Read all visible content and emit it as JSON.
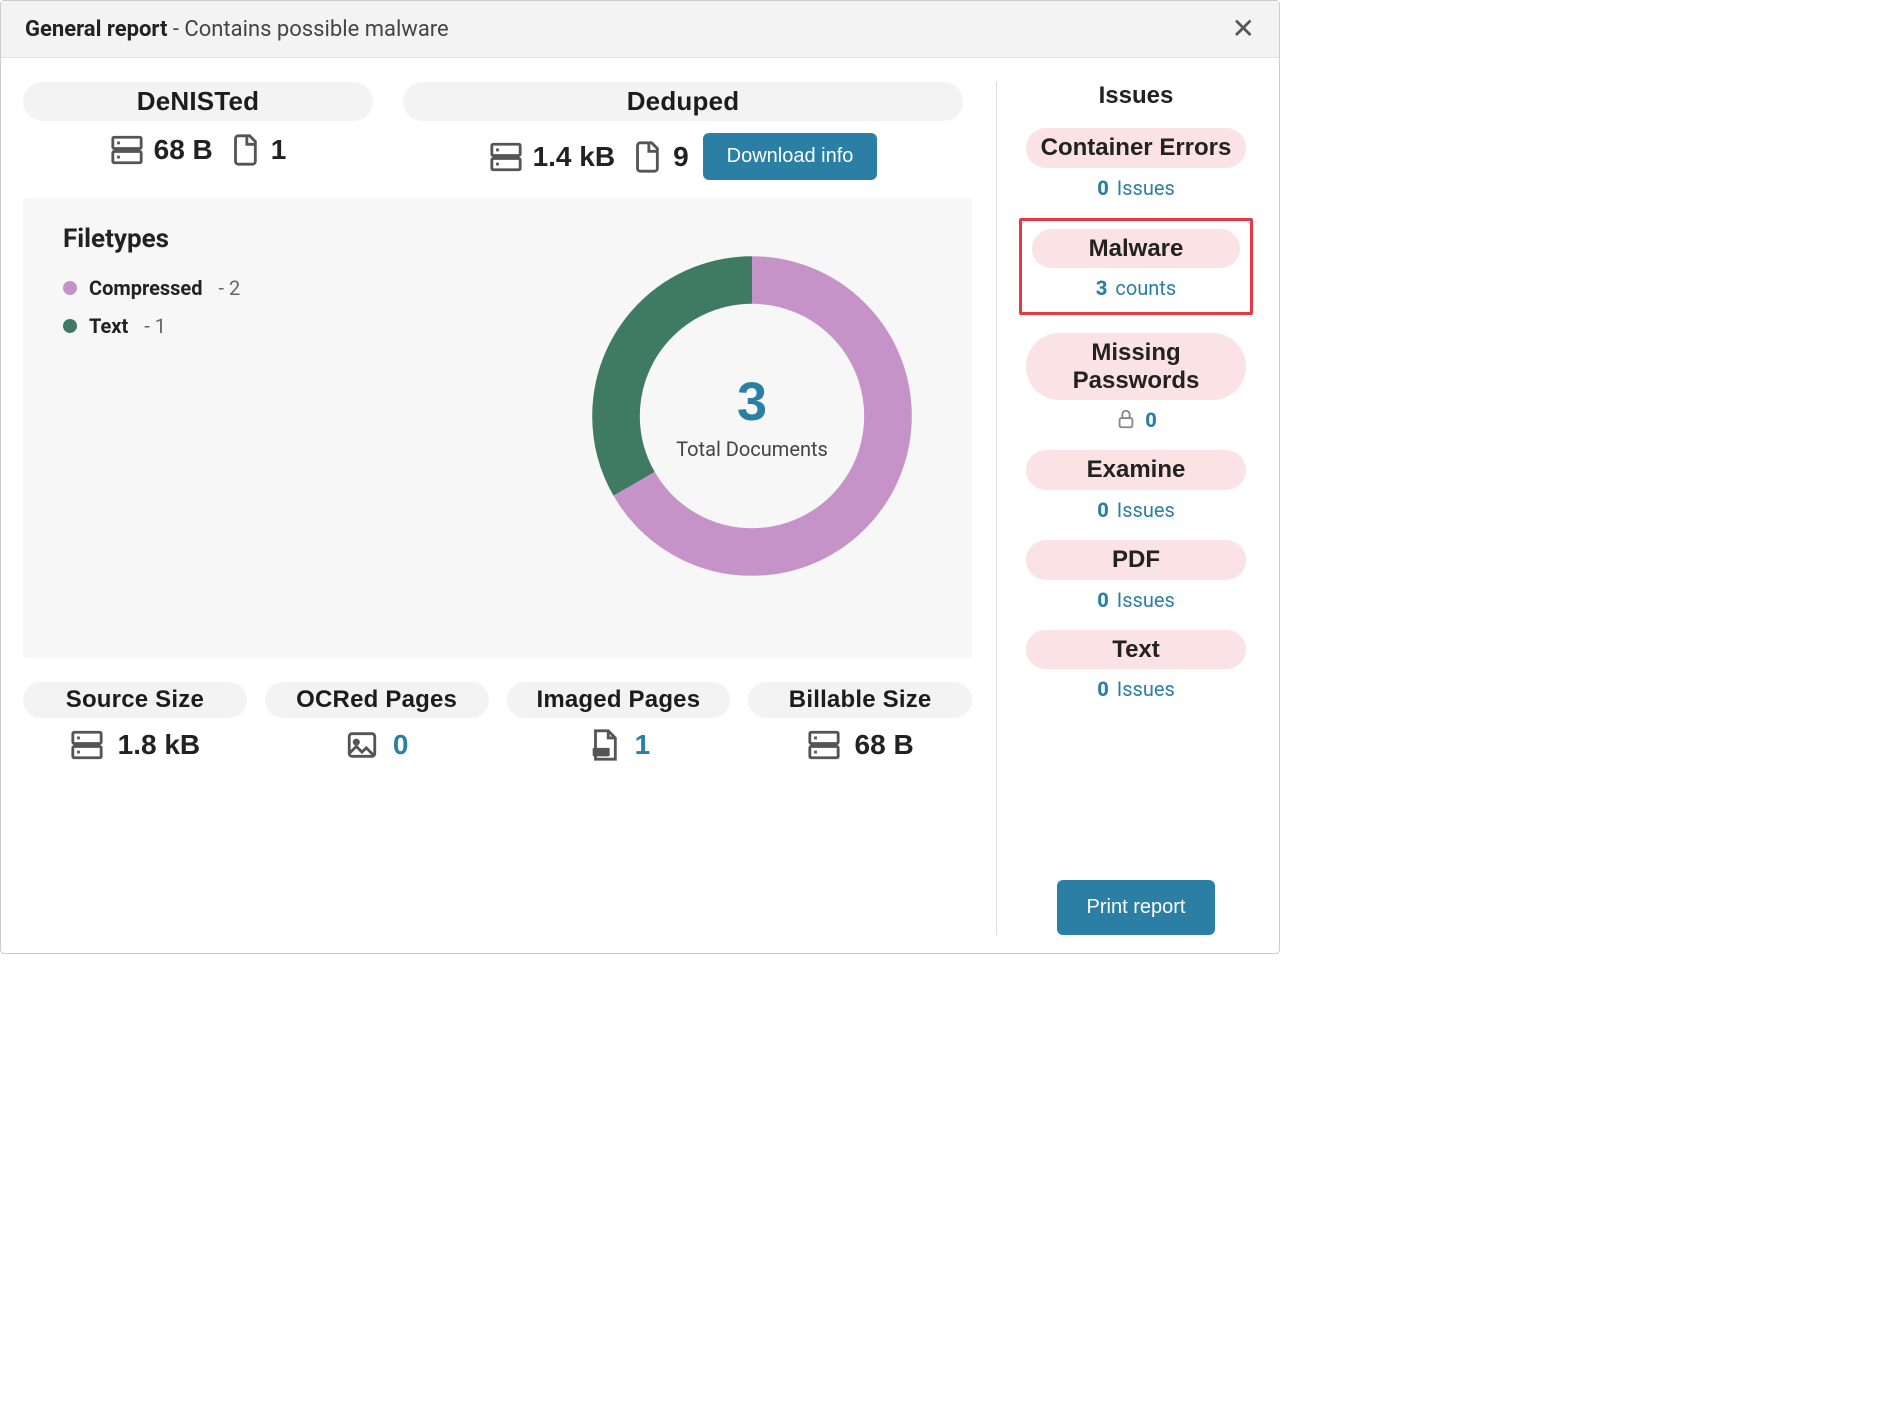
{
  "header": {
    "title_bold": "General report",
    "title_rest": " - Contains possible malware"
  },
  "top": {
    "denisted": {
      "label": "DeNISTed",
      "size": "68 B",
      "docs": "1"
    },
    "deduped": {
      "label": "Deduped",
      "size": "1.4 kB",
      "docs": "9",
      "download_label": "Download info"
    }
  },
  "filetypes": {
    "title": "Filetypes",
    "center_num": "3",
    "center_label": "Total Documents",
    "items": [
      {
        "name": "Compressed",
        "count": "2",
        "color": "#c593c7"
      },
      {
        "name": "Text",
        "count": "1",
        "color": "#3f7a63"
      }
    ]
  },
  "bottom": {
    "source": {
      "label": "Source Size",
      "value": "1.8 kB"
    },
    "ocr": {
      "label": "OCRed Pages",
      "value": "0"
    },
    "imaged": {
      "label": "Imaged Pages",
      "value": "1"
    },
    "billable": {
      "label": "Billable Size",
      "value": "68 B"
    }
  },
  "issues": {
    "title": "Issues",
    "container": {
      "label": "Container Errors",
      "num": "0",
      "unit": "Issues"
    },
    "malware": {
      "label": "Malware",
      "num": "3",
      "unit": "counts"
    },
    "passwords": {
      "label": "Missing Passwords",
      "num": "0"
    },
    "examine": {
      "label": "Examine",
      "num": "0",
      "unit": "Issues"
    },
    "pdf": {
      "label": "PDF",
      "num": "0",
      "unit": "Issues"
    },
    "text": {
      "label": "Text",
      "num": "0",
      "unit": "Issues"
    },
    "print_label": "Print report"
  },
  "chart_data": {
    "type": "pie",
    "title": "Filetypes",
    "categories": [
      "Compressed",
      "Text"
    ],
    "values": [
      2,
      1
    ],
    "colors": [
      "#c593c7",
      "#3f7a63"
    ],
    "center_label": "Total Documents",
    "center_value": 3
  }
}
